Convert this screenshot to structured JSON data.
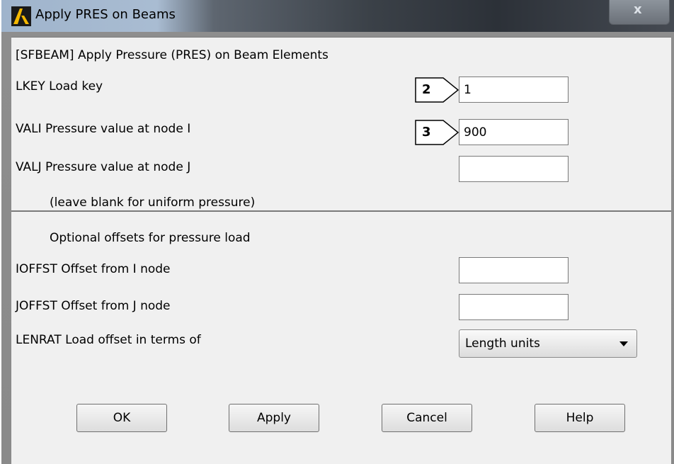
{
  "window": {
    "title": "Apply PRES on Beams",
    "close_glyph": "x"
  },
  "dialog": {
    "heading": "[SFBEAM]  Apply Pressure (PRES) on Beam Elements",
    "lkey_label": "LKEY   Load key",
    "lkey_value": "1",
    "vali_label": "VALI   Pressure value at node I",
    "vali_value": "900",
    "valj_label": "VALJ    Pressure value at node J",
    "valj_value": "",
    "blank_note": "(leave blank for uniform pressure)",
    "offsets_heading": "Optional offsets for pressure load",
    "ioffst_label": "IOFFST     Offset from I node",
    "ioffst_value": "",
    "joffst_label": "JOFFST     Offset from J node",
    "joffst_value": "",
    "lenrat_label": "LENRAT   Load offset in terms of",
    "lenrat_selected": "Length units"
  },
  "callouts": {
    "lkey": "2",
    "vali": "3"
  },
  "buttons": {
    "ok": "OK",
    "apply": "Apply",
    "cancel": "Cancel",
    "help": "Help"
  },
  "icons": {
    "title": "ansys-logo-icon",
    "close": "close-icon",
    "dropdown": "chevron-down-icon"
  },
  "colors": {
    "panel_bg": "#f0f0f0",
    "logo_yellow": "#f5b800"
  }
}
